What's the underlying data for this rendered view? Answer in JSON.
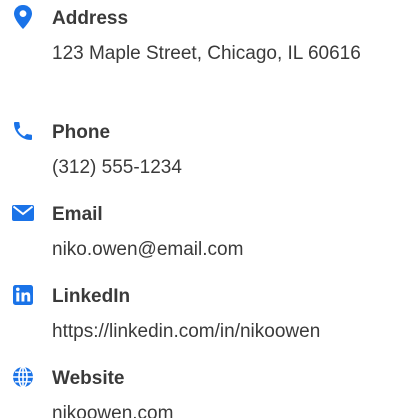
{
  "accent_color": "#1a73e8",
  "contacts": [
    {
      "icon": "map-pin-icon",
      "label": "Address",
      "value": "123 Maple Street, Chicago, IL 60616"
    },
    {
      "icon": "phone-icon",
      "label": "Phone",
      "value": "(312) 555-1234"
    },
    {
      "icon": "envelope-icon",
      "label": "Email",
      "value": "niko.owen@email.com"
    },
    {
      "icon": "linkedin-icon",
      "label": "LinkedIn",
      "value": "https://linkedin.com/in/nikoowen"
    },
    {
      "icon": "globe-icon",
      "label": "Website",
      "value": "nikoowen.com"
    }
  ]
}
